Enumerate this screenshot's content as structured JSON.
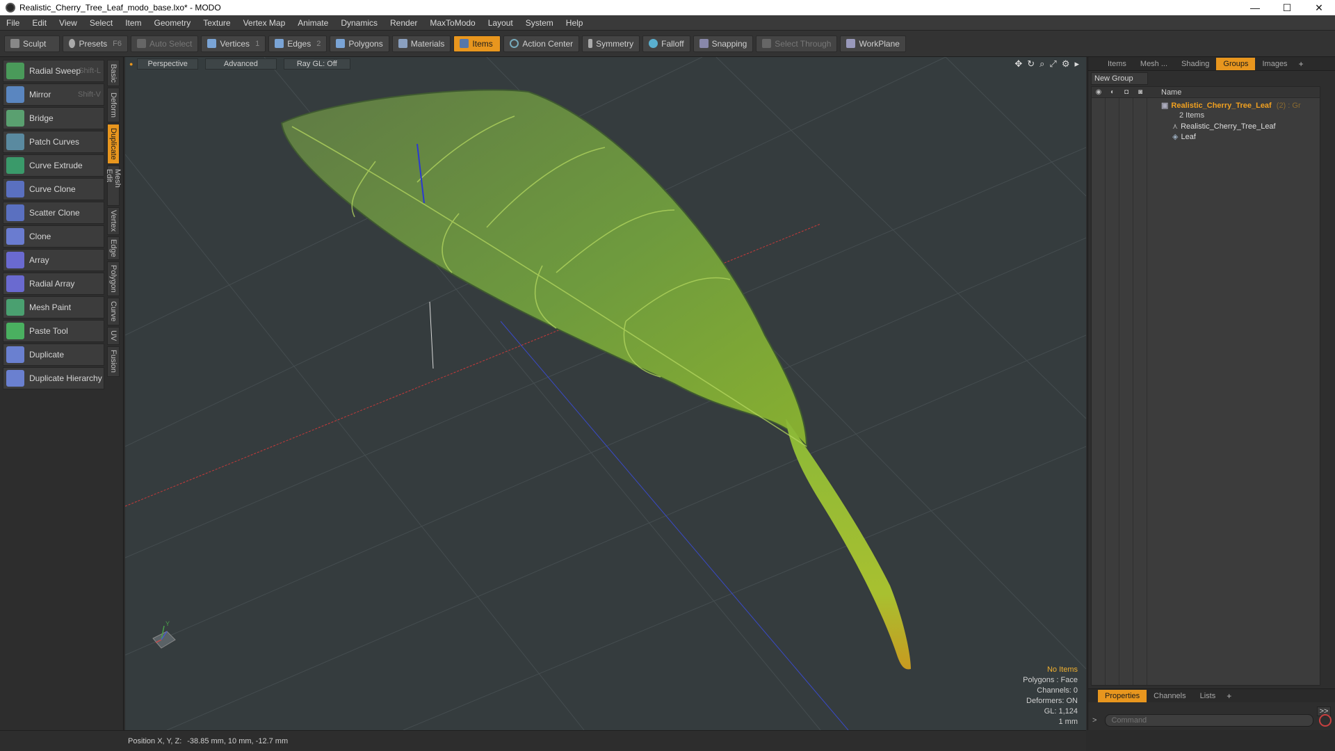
{
  "window": {
    "title": "Realistic_Cherry_Tree_Leaf_modo_base.lxo* - MODO",
    "minimize": "—",
    "maximize": "☐",
    "close": "✕"
  },
  "menu": [
    "File",
    "Edit",
    "View",
    "Select",
    "Item",
    "Geometry",
    "Texture",
    "Vertex Map",
    "Animate",
    "Dynamics",
    "Render",
    "MaxToModo",
    "Layout",
    "System",
    "Help"
  ],
  "toolbar": {
    "sculpt": "Sculpt",
    "presets": "Presets",
    "presets_key": "F6",
    "auto_select": "Auto Select",
    "vertices": "Vertices",
    "vertices_count": "1",
    "edges": "Edges",
    "edges_count": "2",
    "polygons": "Polygons",
    "materials": "Materials",
    "items": "Items",
    "action_center": "Action Center",
    "symmetry": "Symmetry",
    "falloff": "Falloff",
    "snapping": "Snapping",
    "select_through": "Select Through",
    "workplane": "WorkPlane"
  },
  "tools": [
    {
      "label": "Radial Sweep",
      "shortcut": "Shift-L",
      "color": "#4a9a5a"
    },
    {
      "label": "Mirror",
      "shortcut": "Shift-V",
      "color": "#5a86c0"
    },
    {
      "label": "Bridge",
      "shortcut": "",
      "color": "#5aa070"
    },
    {
      "label": "Patch Curves",
      "shortcut": "",
      "color": "#5a8aa0"
    },
    {
      "label": "Curve Extrude",
      "shortcut": "",
      "color": "#3a9a6a"
    },
    {
      "label": "Curve Clone",
      "shortcut": "",
      "color": "#5a70c0"
    },
    {
      "label": "Scatter Clone",
      "shortcut": "",
      "color": "#5a70c0"
    },
    {
      "label": "Clone",
      "shortcut": "",
      "color": "#6a7cd0"
    },
    {
      "label": "Array",
      "shortcut": "",
      "color": "#6a6ad0"
    },
    {
      "label": "Radial Array",
      "shortcut": "",
      "color": "#6a6ad0"
    },
    {
      "label": "Mesh Paint",
      "shortcut": "",
      "color": "#4aa070"
    },
    {
      "label": "Paste Tool",
      "shortcut": "",
      "color": "#4ab060"
    },
    {
      "label": "Duplicate",
      "shortcut": "",
      "color": "#6a80d0"
    },
    {
      "label": "Duplicate Hierarchy",
      "shortcut": "",
      "color": "#6a80d0"
    }
  ],
  "side_tabs": [
    "Basic",
    "Deform",
    "Duplicate",
    "Mesh Edit",
    "Vertex",
    "Edge",
    "Polygon",
    "Curve",
    "UV",
    "Fusion"
  ],
  "side_tab_active": "Duplicate",
  "viewport": {
    "view": "Perspective",
    "shading": "Advanced",
    "raygl": "Ray GL: Off",
    "axis_x_color": "#c83a3a",
    "axis_z_color": "#3a4ac8",
    "hud": {
      "selection": "No Items",
      "polygons": "Polygons : Face",
      "channels": "Channels: 0",
      "deformers": "Deformers: ON",
      "gl": "GL: 1,124",
      "unit": "1 mm"
    },
    "axis_gizmo": {
      "y": "Y"
    }
  },
  "status": {
    "label": "Position X, Y, Z:",
    "value": "-38.85 mm, 10 mm, -12.7 mm"
  },
  "right_panel": {
    "tabs": [
      "Items",
      "Mesh ...",
      "Shading",
      "Groups",
      "Images"
    ],
    "active_tab": "Groups",
    "new_group": "New Group",
    "name_header": "Name",
    "group_name": "Realistic_Cherry_Tree_Leaf",
    "group_suffix": "(2) : Gr",
    "group_count": "2 Items",
    "children": [
      "Realistic_Cherry_Tree_Leaf",
      "Leaf"
    ],
    "bottom_tabs": [
      "Properties",
      "Channels",
      "Lists"
    ],
    "active_bottom_tab": "Properties",
    "expand": ">>",
    "command_placeholder": "Command"
  }
}
